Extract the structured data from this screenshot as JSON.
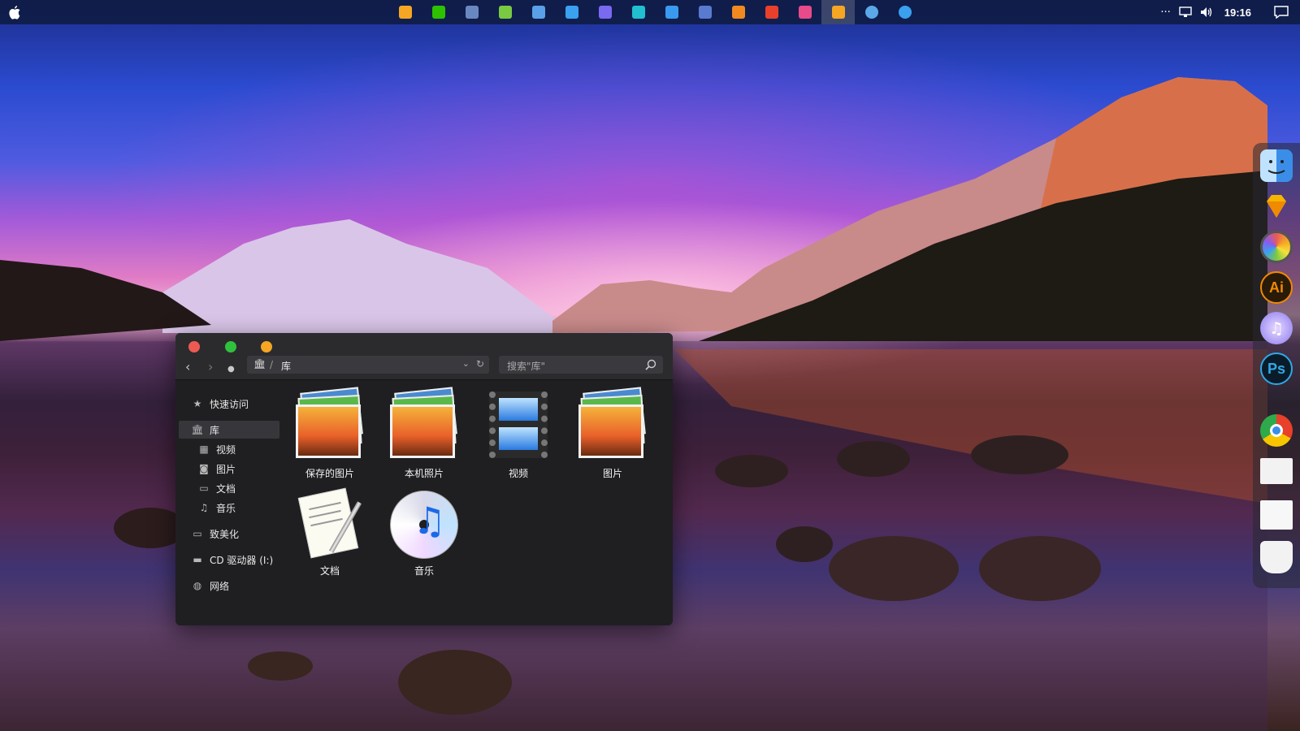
{
  "topbar": {
    "apps": [
      {
        "icon": "sticker-app-icon",
        "color": "#f5a623"
      },
      {
        "icon": "wechat-icon",
        "color": "#2dc100"
      },
      {
        "icon": "ps-file-icon",
        "color": "#6a88c0"
      },
      {
        "icon": "graph-app-icon",
        "color": "#7ac943"
      },
      {
        "icon": "photos-app-icon",
        "color": "#5aa0e8"
      },
      {
        "icon": "palette-icon",
        "color": "#3aa0f0"
      },
      {
        "icon": "media-player-icon",
        "color": "#7a6af0"
      },
      {
        "icon": "screen-icon",
        "color": "#20c0d0"
      },
      {
        "icon": "clipboard-icon",
        "color": "#3a9af0"
      },
      {
        "icon": "terminal-icon",
        "color": "#5a7ad0"
      },
      {
        "icon": "multitask-icon",
        "color": "#f08a20"
      },
      {
        "icon": "weibo-icon",
        "color": "#e8402a"
      },
      {
        "icon": "meitu-icon",
        "color": "#e84a8a"
      },
      {
        "icon": "folder-icon",
        "color": "#f5a623"
      },
      {
        "icon": "qq-icon",
        "color": "#5aa8e8"
      },
      {
        "icon": "chat-bubble-icon",
        "color": "#3aa0f0"
      }
    ],
    "time": "19:16"
  },
  "dock": [
    {
      "icon": "finder-icon",
      "color": "#3a8ee8"
    },
    {
      "icon": "sketch-icon",
      "color": "#f7b500"
    },
    {
      "icon": "color-wheel-icon",
      "color": "#e85a5a"
    },
    {
      "icon": "illustrator-icon",
      "color": "#f08a00"
    },
    {
      "icon": "itunes-icon",
      "color": "#8a7af0"
    },
    {
      "icon": "photoshop-icon",
      "color": "#2fa8e8"
    },
    {
      "icon": "chrome-icon",
      "color": "#e8402a"
    },
    {
      "icon": "document-preview-icon",
      "color": "#e8e8e8"
    },
    {
      "icon": "notes-preview-icon",
      "color": "#e8e8e8"
    },
    {
      "icon": "cup-icon",
      "color": "#f2f2f2"
    }
  ],
  "window": {
    "path": {
      "location": "库"
    },
    "search_placeholder": "搜索\"库\"",
    "sidebar": {
      "quick_access": "快速访问",
      "library": "库",
      "videos": "视频",
      "pictures": "图片",
      "documents": "文档",
      "music": "音乐",
      "this_pc": "致美化",
      "cd_drive": "CD 驱动器 (I:)",
      "network": "网络"
    },
    "items": [
      {
        "label": "保存的图片",
        "kind": "photo"
      },
      {
        "label": "本机照片",
        "kind": "photo"
      },
      {
        "label": "视频",
        "kind": "film"
      },
      {
        "label": "图片",
        "kind": "photo"
      },
      {
        "label": "文档",
        "kind": "doc"
      },
      {
        "label": "音乐",
        "kind": "music"
      }
    ]
  }
}
